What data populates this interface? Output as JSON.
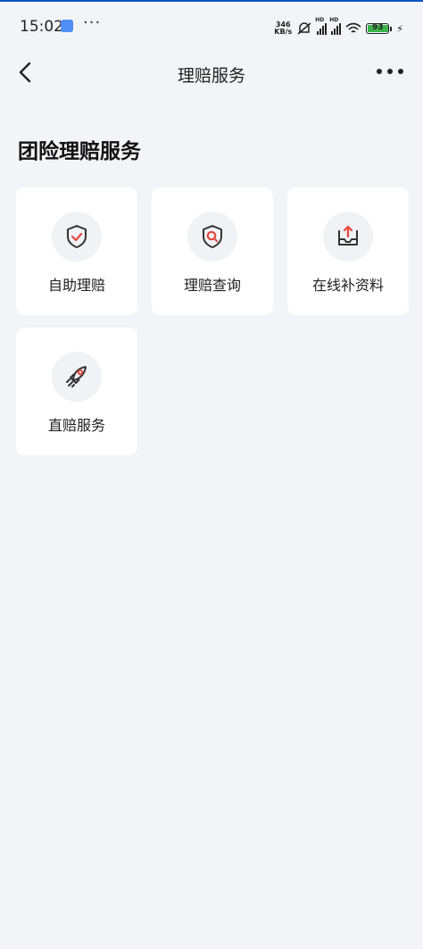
{
  "status_bar": {
    "time": "15:02",
    "dots": "···",
    "net_speed_value": "346",
    "net_speed_unit": "KB/s",
    "signal_label": "HD",
    "battery": "93",
    "accent_color": "#3bb54a"
  },
  "nav": {
    "title": "理赔服务",
    "back_icon": "chevron-left-icon",
    "more_icon": "more-horizontal-icon"
  },
  "section": {
    "title": "团险理赔服务"
  },
  "services": [
    {
      "label": "自助理赔",
      "icon": "shield-check-icon"
    },
    {
      "label": "理赔查询",
      "icon": "shield-search-icon"
    },
    {
      "label": "在线补资料",
      "icon": "tray-upload-icon"
    },
    {
      "label": "直赔服务",
      "icon": "rocket-icon"
    }
  ],
  "colors": {
    "icon_red": "#e8473c",
    "icon_dark": "#333333",
    "background": "#f3f4f8"
  }
}
